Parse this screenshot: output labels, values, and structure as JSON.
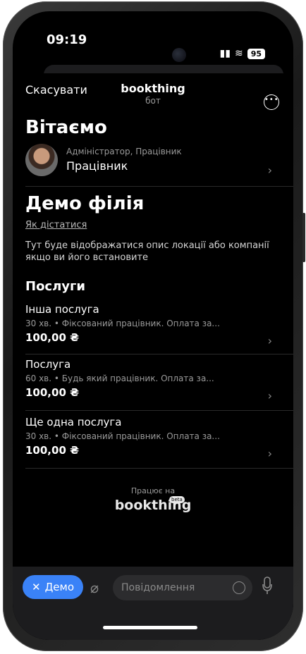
{
  "status_bar": {
    "time": "09:19",
    "battery": "95"
  },
  "header": {
    "cancel": "Скасувати",
    "bot_name": "bookthing",
    "bot_sub": "бот"
  },
  "greeting": "Вітаємо",
  "user": {
    "roles": "Адміністратор, Працівник",
    "name": "Працівник"
  },
  "branch": {
    "name": "Демо філія",
    "directions_link": "Як дістатися",
    "description": "Тут буде відображатися опис локації або компанії якщо ви його встановите"
  },
  "services": {
    "heading": "Послуги",
    "items": [
      {
        "name": "Інша послуга",
        "meta": "30 хв. • Фіксований працівник. Оплата за...",
        "price": "100,00 ₴"
      },
      {
        "name": "Послуга",
        "meta": "60 хв. • Будь який працівник. Оплата за...",
        "price": "100,00 ₴"
      },
      {
        "name": "Ще одна послуга",
        "meta": "30 хв. • Фіксований працівник. Оплата за...",
        "price": "100,00 ₴"
      }
    ]
  },
  "footer": {
    "powered_by": "Працює на",
    "brand": "bookthing",
    "badge": "beta"
  },
  "input_bar": {
    "demo_label": "Демо",
    "message_placeholder": "Повідомлення"
  },
  "colors": {
    "accent": "#3a82f7",
    "background": "#000000"
  }
}
